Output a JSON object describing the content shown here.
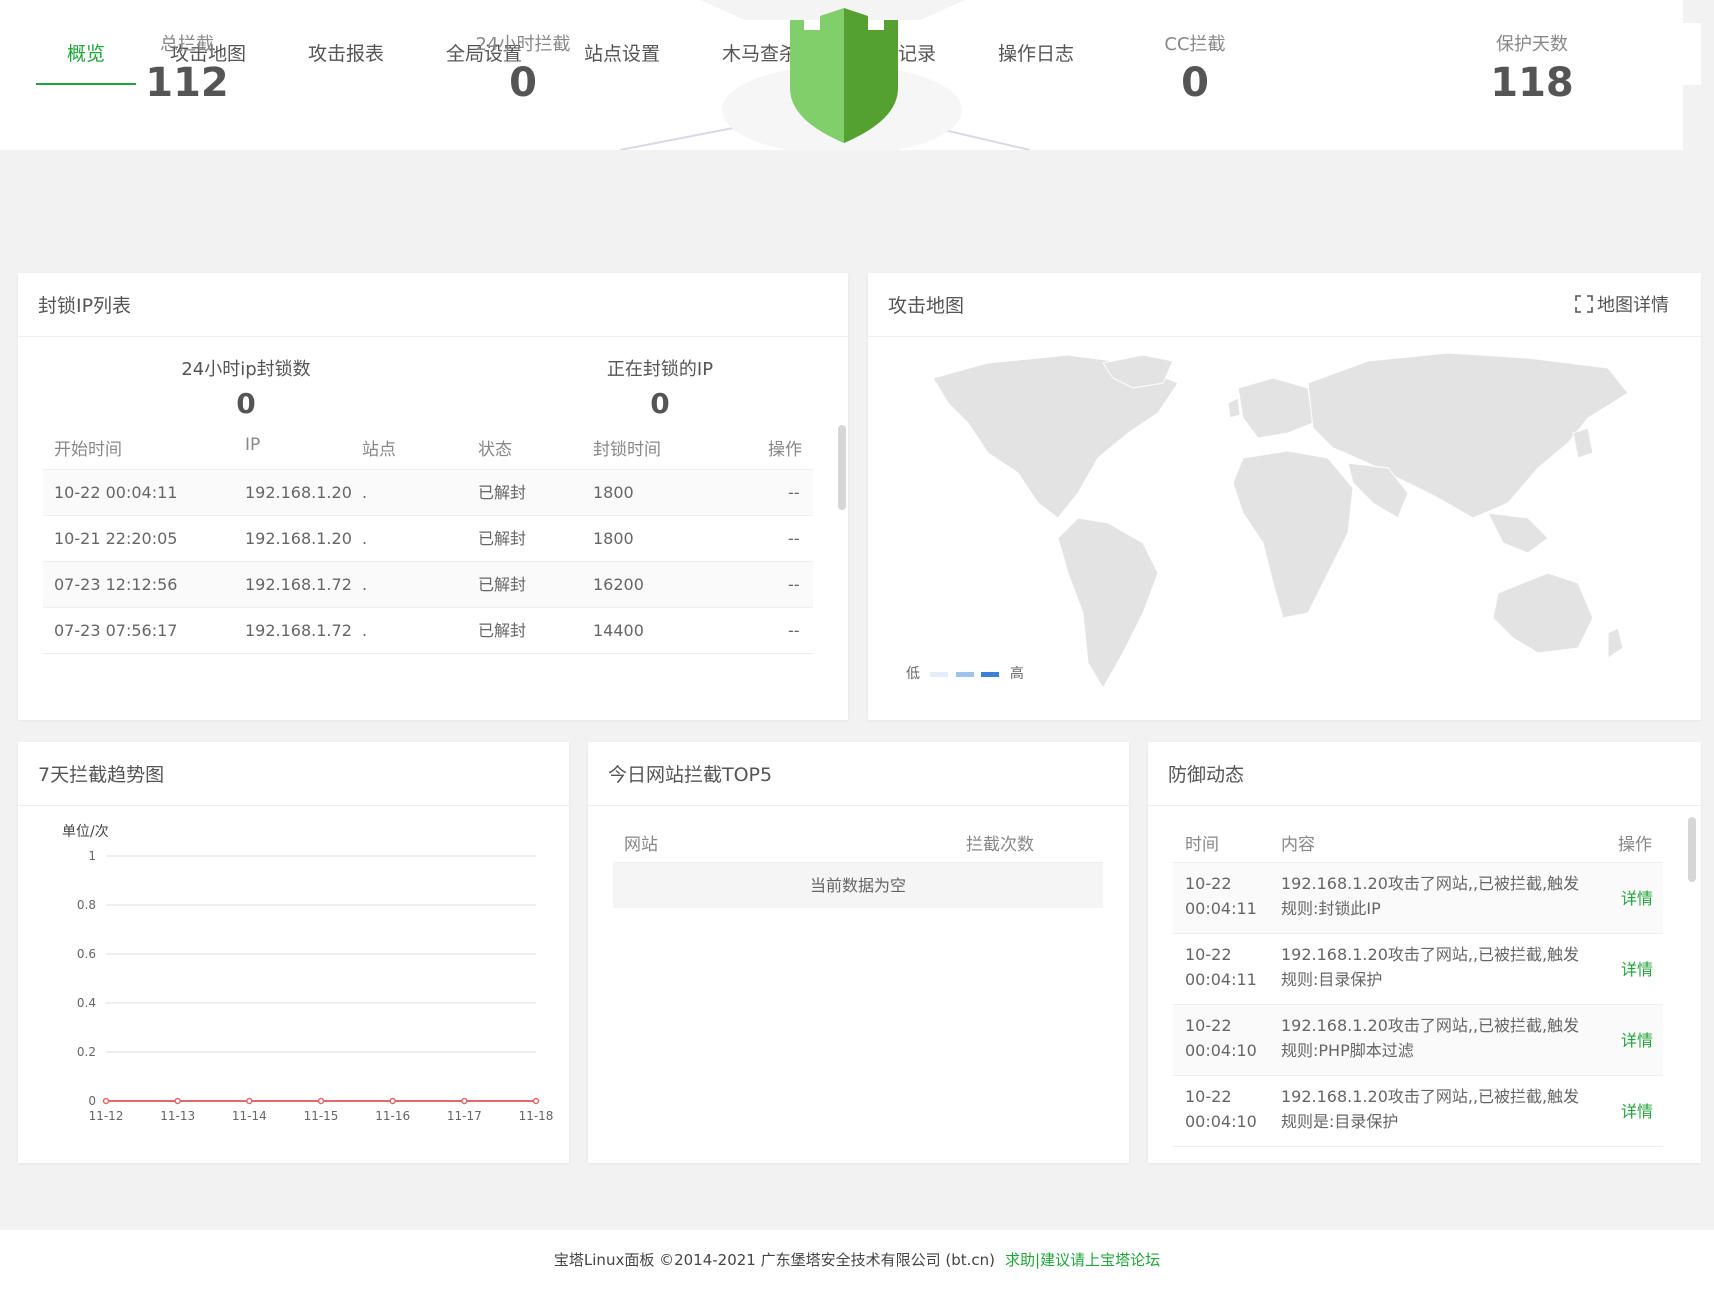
{
  "nav": {
    "tabs": [
      "概览",
      "攻击地图",
      "攻击报表",
      "全局设置",
      "站点设置",
      "木马查杀",
      "封锁记录",
      "操作日志"
    ]
  },
  "stats": {
    "total": {
      "label": "总拦截",
      "value": "112"
    },
    "h24": {
      "label": "24小时拦截",
      "value": "0"
    },
    "cc": {
      "label": "CC拦截",
      "value": "0"
    },
    "days": {
      "label": "保护天数",
      "value": "118"
    }
  },
  "blocked": {
    "title": "封锁IP列表",
    "ip24": {
      "label": "24小时ip封锁数",
      "value": "0"
    },
    "current": {
      "label": "正在封锁的IP",
      "value": "0"
    },
    "headers": [
      "开始时间",
      "IP",
      "站点",
      "状态",
      "封锁时间",
      "操作"
    ],
    "rows": [
      [
        "10-22 00:04:11",
        "192.168.1.20",
        ".",
        "已解封",
        "1800",
        "--"
      ],
      [
        "10-21 22:20:05",
        "192.168.1.20",
        ".",
        "已解封",
        "1800",
        "--"
      ],
      [
        "07-23 12:12:56",
        "192.168.1.72",
        ".",
        "已解封",
        "16200",
        "--"
      ],
      [
        "07-23 07:56:17",
        "192.168.1.72",
        ".",
        "已解封",
        "14400",
        "--"
      ]
    ]
  },
  "attack_map": {
    "title": "攻击地图",
    "detail": "地图详情",
    "legend_low": "低",
    "legend_high": "高"
  },
  "trend": {
    "title": "7天拦截趋势图"
  },
  "chart_data": {
    "type": "line",
    "x": [
      "11-12",
      "11-13",
      "11-14",
      "11-15",
      "11-16",
      "11-17",
      "11-18"
    ],
    "series": [
      {
        "values": [
          0,
          0,
          0,
          0,
          0,
          0,
          0
        ],
        "color": "#e06a6a"
      }
    ],
    "ylabel": "单位/次",
    "ylim": [
      0,
      1
    ],
    "yticks": [
      "0",
      "0.2",
      "0.4",
      "0.6",
      "0.8",
      "1"
    ],
    "grid": true
  },
  "top5": {
    "title": "今日网站拦截TOP5",
    "headers": [
      "网站",
      "拦截次数"
    ],
    "empty": "当前数据为空"
  },
  "defense": {
    "title": "防御动态",
    "headers": [
      "时间",
      "内容",
      "操作"
    ],
    "rows": [
      {
        "date": "10-22",
        "time": "00:04:11",
        "line1": "192.168.1.20攻击了网站,,已被拦截,触发",
        "line2": "规则:封锁此IP",
        "op": "详情"
      },
      {
        "date": "10-22",
        "time": "00:04:11",
        "line1": "192.168.1.20攻击了网站,,已被拦截,触发",
        "line2": "规则:目录保护",
        "op": "详情"
      },
      {
        "date": "10-22",
        "time": "00:04:10",
        "line1": "192.168.1.20攻击了网站,,已被拦截,触发",
        "line2": "规则:PHP脚本过滤",
        "op": "详情"
      },
      {
        "date": "10-22",
        "time": "00:04:10",
        "line1": "192.168.1.20攻击了网站,,已被拦截,触发",
        "line2": "规则是:目录保护",
        "op": "详情"
      }
    ]
  },
  "footer": {
    "copyright": "宝塔Linux面板 ©2014-2021 广东堡塔安全技术有限公司 (bt.cn)",
    "link": "求助|建议请上宝塔论坛"
  },
  "colors": {
    "accent": "#20a53a",
    "shield_light": "#7ed068",
    "shield_dark": "#4c9a2a"
  }
}
